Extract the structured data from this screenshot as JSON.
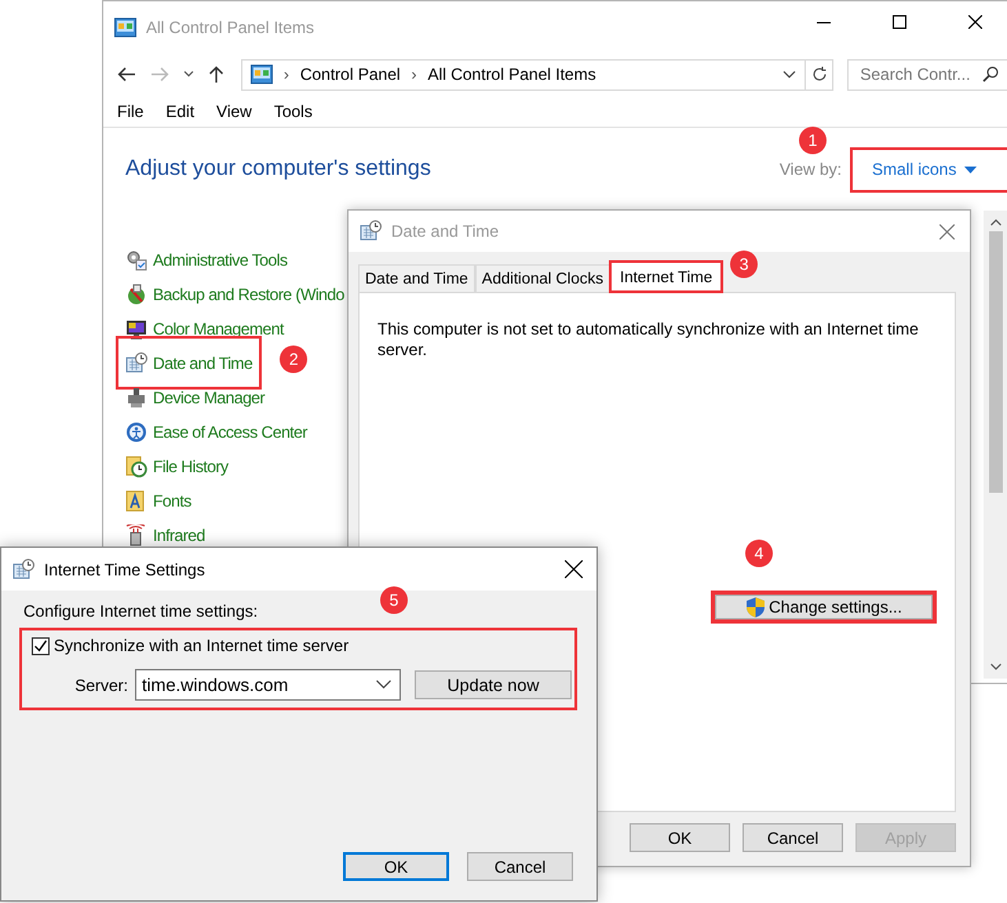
{
  "control_panel": {
    "title": "All Control Panel Items",
    "breadcrumb": [
      {
        "separator": "›",
        "label": "Control Panel"
      },
      {
        "separator": "›",
        "label": "All Control Panel Items"
      }
    ],
    "search": {
      "placeholder": "Search Contr..."
    },
    "menu": [
      "File",
      "Edit",
      "View",
      "Tools"
    ],
    "heading": "Adjust your computer's settings",
    "view_by": {
      "label": "View by:",
      "value": "Small icons",
      "highlighted": true,
      "badge": "1"
    },
    "items": [
      {
        "label": "Administrative Tools",
        "highlighted": false
      },
      {
        "label": "Backup and Restore (Windo",
        "highlighted": false
      },
      {
        "label": "Color Management",
        "highlighted": false
      },
      {
        "label": "Date and Time",
        "highlighted": true,
        "badge": "2"
      },
      {
        "label": "Device Manager",
        "highlighted": false
      },
      {
        "label": "Ease of Access Center",
        "highlighted": false
      },
      {
        "label": "File History",
        "highlighted": false
      },
      {
        "label": "Fonts",
        "highlighted": false
      },
      {
        "label": "Infrared",
        "highlighted": false
      }
    ]
  },
  "date_time": {
    "title": "Date and Time",
    "tabs": [
      {
        "label": "Date and Time",
        "selected": false,
        "highlighted": false
      },
      {
        "label": "Additional Clocks",
        "selected": false,
        "highlighted": false
      },
      {
        "label": "Internet Time",
        "selected": true,
        "highlighted": true,
        "badge": "3"
      }
    ],
    "message": "This computer is not set to automatically synchronize with an Internet time server.",
    "change_settings": {
      "label": "Change settings...",
      "highlighted": true,
      "badge": "4"
    },
    "buttons": [
      {
        "label": "OK",
        "disabled": false
      },
      {
        "label": "Cancel",
        "disabled": false
      },
      {
        "label": "Apply",
        "disabled": true
      }
    ]
  },
  "internet_time_settings": {
    "title": "Internet Time Settings",
    "prompt": "Configure Internet time settings:",
    "group": {
      "highlighted": true,
      "badge": "5"
    },
    "sync": {
      "label": "Synchronize with an Internet time server",
      "checked": true
    },
    "server": {
      "label": "Server:",
      "value": "time.windows.com"
    },
    "update_button": "Update now",
    "buttons": [
      {
        "label": "OK",
        "default": true
      },
      {
        "label": "Cancel",
        "default": false
      }
    ]
  }
}
